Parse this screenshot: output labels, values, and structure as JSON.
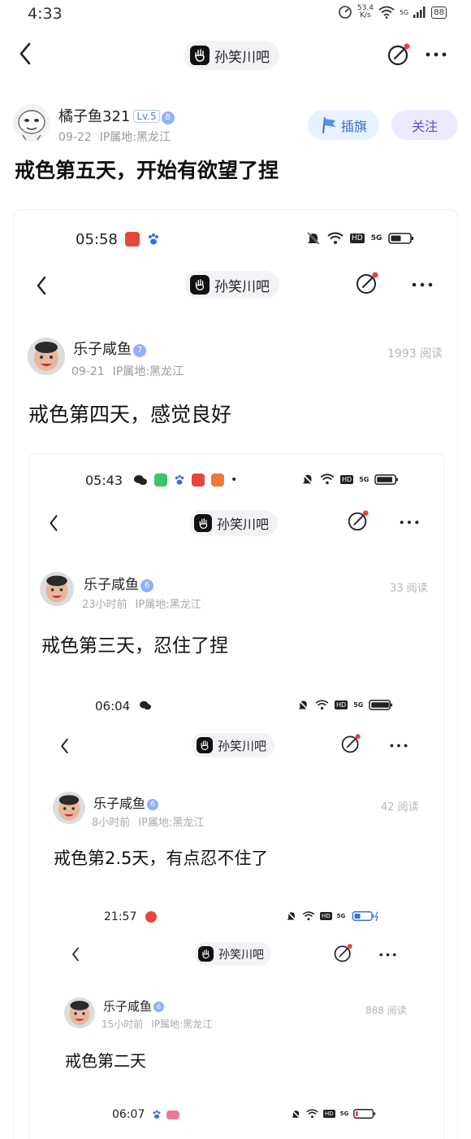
{
  "status_bar": {
    "time": "4:33",
    "net_speed_top": "53.4",
    "net_speed_bottom": "K/s",
    "network": "5G",
    "battery": "88"
  },
  "nav": {
    "forum_name": "孙笑川吧"
  },
  "author": {
    "name": "橘子鱼321",
    "level": "Lv.5",
    "badge_num": "8",
    "date": "09-22",
    "ip": "IP属地:黑龙江"
  },
  "actions": {
    "flag_label": "插旗",
    "follow_label": "关注"
  },
  "post": {
    "title": "戒色第五天，开始有欲望了捏"
  },
  "nested": [
    {
      "time": "05:58",
      "forum": "孙笑川吧",
      "author": "乐子咸鱼",
      "badge_num": "7",
      "date": "09-21",
      "ip": "IP属地:黑龙江",
      "reads": "1993 阅读",
      "title": "戒色第四天，感觉良好"
    },
    {
      "time": "05:43",
      "forum": "孙笑川吧",
      "author": "乐子咸鱼",
      "badge_num": "6",
      "date": "23小时前",
      "ip": "IP属地:黑龙江",
      "reads": "33 阅读",
      "title": "戒色第三天，忍住了捏"
    },
    {
      "time": "06:04",
      "forum": "孙笑川吧",
      "author": "乐子咸鱼",
      "badge_num": "6",
      "date": "8小时前",
      "ip": "IP属地:黑龙江",
      "reads": "42 阅读",
      "title": "戒色第2.5天，有点忍不住了"
    },
    {
      "time": "21:57",
      "forum": "孙笑川吧",
      "author": "乐子咸鱼",
      "badge_num": "6",
      "date": "15小时前",
      "ip": "IP属地:黑龙江",
      "reads": "888 阅读",
      "title": "戒色第二天"
    },
    {
      "time": "06:07"
    }
  ],
  "icon_labels": {
    "hd": "HD",
    "g5": "5G"
  },
  "colors": {
    "accent_blue": "#3b6ad8",
    "follow_purple": "#5a4fd6",
    "notify_red": "#f03e3e"
  }
}
